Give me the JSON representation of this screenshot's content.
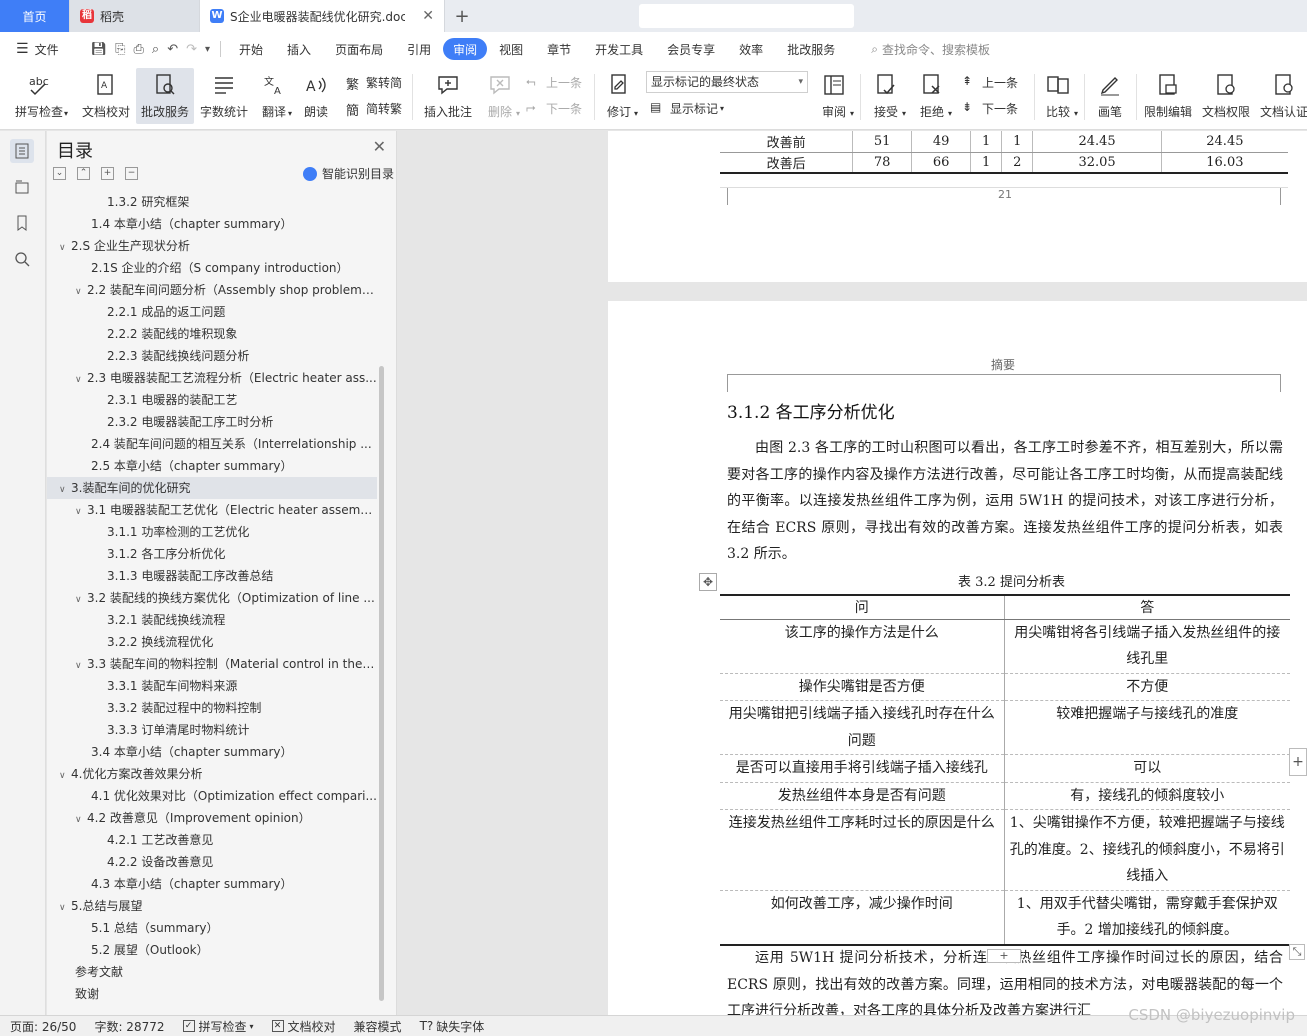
{
  "tabs": {
    "home": "首页",
    "daoke": "稻壳",
    "doc": "S企业电暖器装配线优化研究.doc"
  },
  "menu": {
    "file": "文件",
    "items": [
      "开始",
      "插入",
      "页面布局",
      "引用",
      "审阅",
      "视图",
      "章节",
      "开发工具",
      "会员专享",
      "效率",
      "批改服务"
    ],
    "active": "审阅",
    "search": "查找命令、搜索模板"
  },
  "ribbon": {
    "spell": "拼写检查",
    "proof": "文档校对",
    "correct": "批改服务",
    "wordcount": "字数统计",
    "translate": "翻译",
    "read": "朗读",
    "trad": "繁转简",
    "simp": "简转繁",
    "insert_comment": "插入批注",
    "delete": "删除",
    "prev": "上一条",
    "next": "下一条",
    "revise": "修订",
    "markup_state": "显示标记的最终状态",
    "show_markup": "显示标记",
    "review": "审阅",
    "accept": "接受",
    "reject": "拒绝",
    "prev2": "上一条",
    "next2": "下一条",
    "compare": "比较",
    "pen": "画笔",
    "restrict": "限制编辑",
    "perm": "文档权限",
    "certify": "文档认证"
  },
  "toc": {
    "title": "目录",
    "smart": "智能识别目录",
    "items": [
      {
        "text": "1.3.2 研究框架",
        "level": 3,
        "arrow": ""
      },
      {
        "text": "1.4 本章小结（chapter summary）",
        "level": 2,
        "arrow": ""
      },
      {
        "text": "2.S 企业生产现状分析",
        "level": 1,
        "arrow": "v"
      },
      {
        "text": "2.1S 企业的介绍（S company introduction）",
        "level": 2,
        "arrow": ""
      },
      {
        "text": "2.2 装配车间问题分析（Assembly shop problem ...",
        "level": 2,
        "arrow": "v"
      },
      {
        "text": "2.2.1 成品的返工问题",
        "level": 3,
        "arrow": ""
      },
      {
        "text": "2.2.2 装配线的堆积现象",
        "level": 3,
        "arrow": ""
      },
      {
        "text": "2.2.3 装配线换线问题分析",
        "level": 3,
        "arrow": ""
      },
      {
        "text": "2.3 电暖器装配工艺流程分析（Electric heater ass...",
        "level": 2,
        "arrow": "v"
      },
      {
        "text": "2.3.1 电暖器的装配工艺",
        "level": 3,
        "arrow": ""
      },
      {
        "text": "2.3.2 电暖器装配工序工时分析",
        "level": 3,
        "arrow": ""
      },
      {
        "text": "2.4 装配车间问题的相互关系（Interrelationship ...",
        "level": 2,
        "arrow": ""
      },
      {
        "text": "2.5 本章小结（chapter summary）",
        "level": 2,
        "arrow": ""
      },
      {
        "text": "3.装配车间的优化研究",
        "level": 1,
        "arrow": "v",
        "selected": true
      },
      {
        "text": "3.1 电暖器装配工艺优化（Electric heater assemb...",
        "level": 2,
        "arrow": "v"
      },
      {
        "text": "3.1.1 功率检测的工艺优化",
        "level": 3,
        "arrow": ""
      },
      {
        "text": "3.1.2 各工序分析优化",
        "level": 3,
        "arrow": ""
      },
      {
        "text": "3.1.3 电暖器装配工序改善总结",
        "level": 3,
        "arrow": ""
      },
      {
        "text": "3.2 装配线的换线方案优化（Optimization of line ...",
        "level": 2,
        "arrow": "v"
      },
      {
        "text": "3.2.1 装配线换线流程",
        "level": 3,
        "arrow": ""
      },
      {
        "text": "3.2.2 换线流程优化",
        "level": 3,
        "arrow": ""
      },
      {
        "text": "3.3 装配车间的物料控制（Material control in the ...",
        "level": 2,
        "arrow": "v"
      },
      {
        "text": "3.3.1 装配车间物料来源",
        "level": 3,
        "arrow": ""
      },
      {
        "text": "3.3.2 装配过程中的物料控制",
        "level": 3,
        "arrow": ""
      },
      {
        "text": "3.3.3 订单清尾时物料统计",
        "level": 3,
        "arrow": ""
      },
      {
        "text": "3.4 本章小结（chapter summary）",
        "level": 2,
        "arrow": ""
      },
      {
        "text": "4.优化方案改善效果分析",
        "level": 1,
        "arrow": "v"
      },
      {
        "text": "4.1 优化效果对比（Optimization effect compari...",
        "level": 2,
        "arrow": ""
      },
      {
        "text": "4.2 改善意见（Improvement opinion）",
        "level": 2,
        "arrow": "v"
      },
      {
        "text": "4.2.1 工艺改善意见",
        "level": 3,
        "arrow": ""
      },
      {
        "text": "4.2.2 设备改善意见",
        "level": 3,
        "arrow": ""
      },
      {
        "text": "4.3 本章小结（chapter summary）",
        "level": 2,
        "arrow": ""
      },
      {
        "text": "5.总结与展望",
        "level": 1,
        "arrow": "v"
      },
      {
        "text": "5.1 总结（summary）",
        "level": 2,
        "arrow": ""
      },
      {
        "text": "5.2 展望（Outlook）",
        "level": 2,
        "arrow": ""
      },
      {
        "text": "参考文献",
        "level": 1,
        "arrow": ""
      },
      {
        "text": "致谢",
        "level": 1,
        "arrow": ""
      }
    ]
  },
  "page1": {
    "rows": [
      [
        "改善前",
        "51",
        "49",
        "1",
        "1",
        "24.45",
        "24.45"
      ],
      [
        "改善后",
        "78",
        "66",
        "1",
        "2",
        "32.05",
        "16.03"
      ]
    ],
    "page_number": "21"
  },
  "page2": {
    "header": "摘要",
    "section_title": "3.1.2 各工序分析优化",
    "para1": "由图 2.3 各工序的工时山积图可以看出，各工序工时参差不齐，相互差别大，所以需要对各工序的操作内容及操作方法进行改善，尽可能让各工序工时均衡，从而提高装配线的平衡率。以连接发热丝组件工序为例，运用 5W1H 的提问技术，对该工序进行分析，在结合 ECRS 原则，寻找出有效的改善方案。连接发热丝组件工序的提问分析表，如表 3.2 所示。",
    "caption": "表 3.2 提问分析表",
    "table_head": [
      "问",
      "答"
    ],
    "table_rows": [
      [
        "该工序的操作方法是什么",
        "用尖嘴钳将各引线端子插入发热丝组件的接线孔里"
      ],
      [
        "操作尖嘴钳是否方便",
        "不方便"
      ],
      [
        "用尖嘴钳把引线端子插入接线孔时存在什么问题",
        "较难把握端子与接线孔的准度"
      ],
      [
        "是否可以直接用手将引线端子插入接线孔",
        "可以"
      ],
      [
        "发热丝组件本身是否有问题",
        "有，接线孔的倾斜度较小"
      ],
      [
        "连接发热丝组件工序耗时过长的原因是什么",
        "1、尖嘴钳操作不方便，较难把握端子与接线孔的准度。2、接线孔的倾斜度小，不易将引线插入"
      ],
      [
        "如何改善工序，减少操作时间",
        "1、用双手代替尖嘴钳，需穿戴手套保护双手。2 增加接线孔的倾斜度。"
      ]
    ],
    "para2": "运用 5W1H 提问分析技术，分析连接发热丝组件工序操作时间过长的原因，结合 ECRS 原则，找出有效的改善方案。同理，运用相同的技术方法，对电暖器装配的每一个工序进行分析改善，对各工序的具体分析及改善方案进行汇"
  },
  "status": {
    "page": "页面: 26/50",
    "words": "字数: 28772",
    "spell": "拼写检查",
    "proof": "文档校对",
    "compat": "兼容模式",
    "missing_font": "缺失字体"
  },
  "watermark": "CSDN @biyezuopinvip",
  "colors": {
    "accent": "#3f7ef7",
    "wps_red": "#e8353a"
  }
}
